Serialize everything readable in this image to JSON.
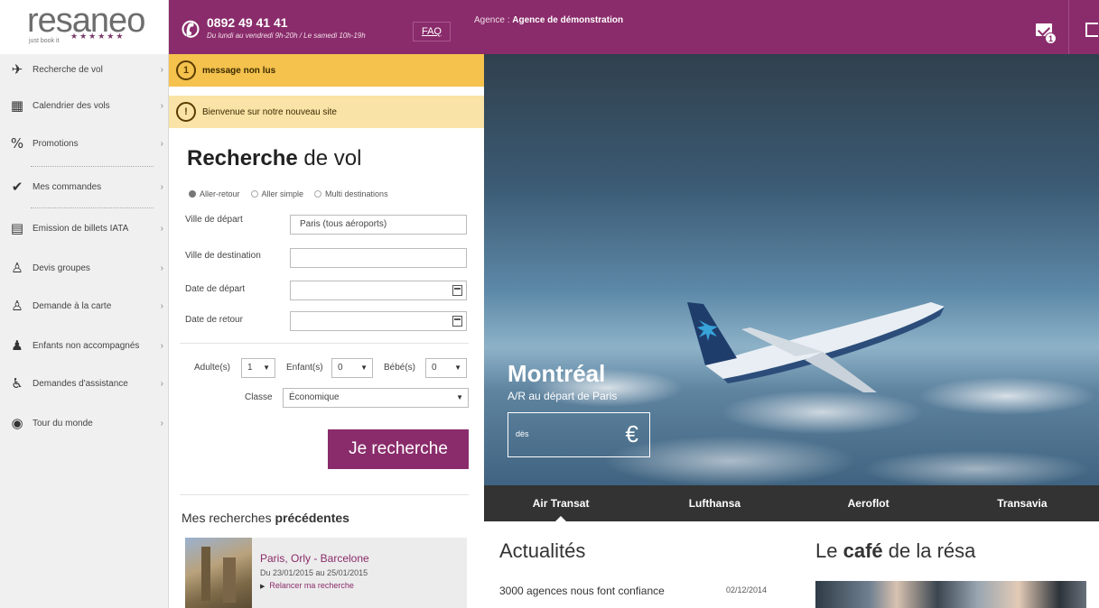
{
  "logo": {
    "text": "resaneo",
    "tagline": "just book it",
    "stars": "★★★★★★"
  },
  "header": {
    "phone": "0892 49 41 41",
    "hours": "Du lundi au vendredi 9h-20h / Le samedi 10h-19h",
    "faq": "FAQ",
    "agence_label": "Agence :",
    "agence_name": "Agence de démonstration",
    "mail_count": "1"
  },
  "sidebar": {
    "items": [
      {
        "label": "Recherche de vol",
        "icon": "plane-icon",
        "glyph": "✈"
      },
      {
        "label": "Calendrier des vols",
        "icon": "calendar-icon",
        "glyph": "▦"
      },
      {
        "label": "Promotions",
        "icon": "percent-icon",
        "glyph": "%"
      },
      {
        "label": "Mes commandes",
        "icon": "check-circle-icon",
        "glyph": "✔"
      },
      {
        "label": "Emission de billets IATA",
        "icon": "printer-icon",
        "glyph": "▤"
      },
      {
        "label": "Devis groupes",
        "icon": "group-icon",
        "glyph": "♙"
      },
      {
        "label": "Demande à la carte",
        "icon": "user-icon",
        "glyph": "♙"
      },
      {
        "label": "Enfants non accompagnés",
        "icon": "children-icon",
        "glyph": "♟"
      },
      {
        "label": "Demandes d'assistance",
        "icon": "accessibility-icon",
        "glyph": "♿"
      },
      {
        "label": "Tour du monde",
        "icon": "globe-icon",
        "glyph": "◉"
      }
    ]
  },
  "messages": {
    "unread_count": "1",
    "unread_label": "message non lus",
    "welcome_icon": "!",
    "welcome": "Bienvenue sur notre nouveau site"
  },
  "form": {
    "title_bold": "Recherche",
    "title_rest": " de vol",
    "trip_types": [
      "Aller-retour",
      "Aller simple",
      "Multi destinations"
    ],
    "departure_label": "Ville de départ",
    "departure_value": "Paris (tous aéroports)",
    "destination_label": "Ville de destination",
    "destination_value": "",
    "date_dep_label": "Date de départ",
    "date_ret_label": "Date de retour",
    "adults_label": "Adulte(s)",
    "adults_value": "1",
    "children_label": "Enfant(s)",
    "children_value": "0",
    "babies_label": "Bébé(s)",
    "babies_value": "0",
    "class_label": "Classe",
    "class_value": "Économique",
    "submit": "Je recherche"
  },
  "previous": {
    "title_plain": "Mes recherches ",
    "title_bold": "précédentes",
    "route": "Paris, Orly - Barcelone",
    "dates": "Du 23/01/2015 au 25/01/2015",
    "relaunch": "Relancer ma recherche"
  },
  "hero": {
    "city": "Montréal",
    "subtitle": "A/R au départ de Paris",
    "from": "dès",
    "currency": "€"
  },
  "tabs": [
    "Air Transat",
    "Lufthansa",
    "Aeroflot",
    "Transavia"
  ],
  "news": {
    "title": "Actualités",
    "item": "3000 agences nous font confiance",
    "date": "02/12/2014"
  },
  "cafe": {
    "title_plain": "Le ",
    "title_bold": "café",
    "title_rest": " de la résa"
  },
  "colors": {
    "brand": "#8a2c6b",
    "notice": "#f4c24d",
    "notice_light": "#f9e3a6",
    "tabbar": "#333333"
  }
}
